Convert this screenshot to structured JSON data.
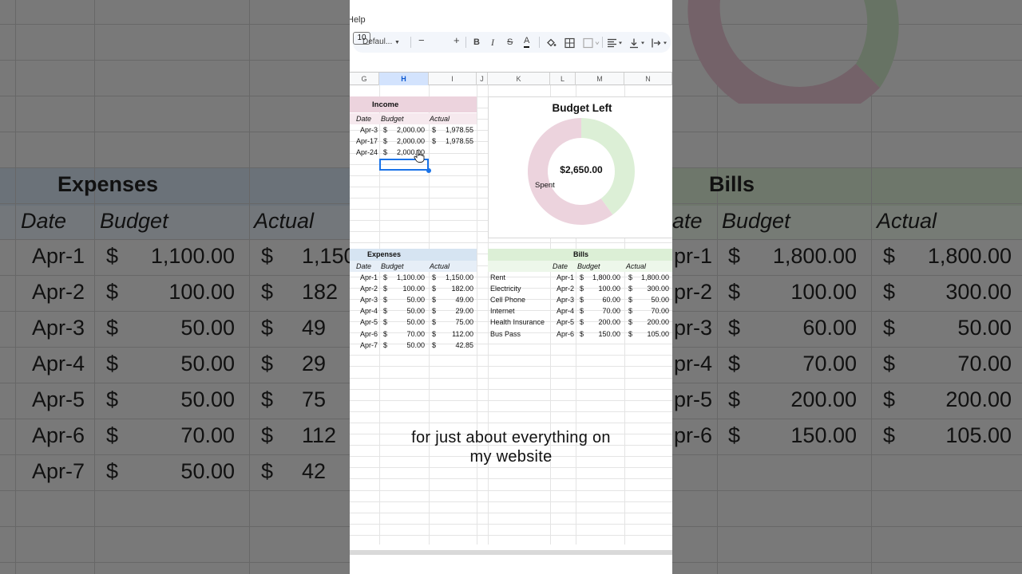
{
  "app": {
    "menu_fragment": "Help",
    "font_name": "Defaul...",
    "font_size": "10",
    "columns": [
      "G",
      "H",
      "I",
      "J",
      "K",
      "L",
      "M",
      "N"
    ],
    "selected_column": "H"
  },
  "toolbar_icons": [
    "minus-icon",
    "plus-icon",
    "bold-icon",
    "italic-icon",
    "strikethrough-icon",
    "text-color-icon",
    "fill-color-icon",
    "borders-icon",
    "merge-cells-icon",
    "align-left-icon",
    "vertical-align-icon",
    "text-wrap-icon"
  ],
  "income": {
    "title": "Income",
    "headers": [
      "Date",
      "Budget",
      "Actual"
    ],
    "rows": [
      {
        "date": "Apr-3",
        "budget": "2,000.00",
        "actual": "1,978.55"
      },
      {
        "date": "Apr-17",
        "budget": "2,000.00",
        "actual": "1,978.55"
      },
      {
        "date": "Apr-24",
        "budget": "2,000.00",
        "actual": ""
      }
    ],
    "currency": "$",
    "color": "#ecd3dd"
  },
  "chart": {
    "title": "Budget Left",
    "center_value": "$2,650.00",
    "slice_label": "Spent",
    "colors": {
      "spent": "#ecd3dd",
      "left": "#dcefd6"
    }
  },
  "chart_data": {
    "type": "pie",
    "title": "Budget Left",
    "categories": [
      "Left",
      "Spent"
    ],
    "values": [
      40,
      60
    ],
    "hole": true
  },
  "expenses": {
    "title": "Expenses",
    "headers": [
      "Date",
      "Budget",
      "Actual"
    ],
    "rows": [
      {
        "date": "Apr-1",
        "budget": "1,100.00",
        "actual": "1,150.00"
      },
      {
        "date": "Apr-2",
        "budget": "100.00",
        "actual": "182.00"
      },
      {
        "date": "Apr-3",
        "budget": "50.00",
        "actual": "49.00"
      },
      {
        "date": "Apr-4",
        "budget": "50.00",
        "actual": "29.00"
      },
      {
        "date": "Apr-5",
        "budget": "50.00",
        "actual": "75.00"
      },
      {
        "date": "Apr-6",
        "budget": "70.00",
        "actual": "112.00"
      },
      {
        "date": "Apr-7",
        "budget": "50.00",
        "actual": "42.85"
      }
    ],
    "currency": "$",
    "color": "#d6e4f2"
  },
  "bills": {
    "title": "Bills",
    "headers": [
      "Date",
      "Budget",
      "Actual"
    ],
    "rows": [
      {
        "name": "Rent",
        "date": "Apr-1",
        "budget": "1,800.00",
        "actual": "1,800.00"
      },
      {
        "name": "Electricity",
        "date": "Apr-2",
        "budget": "100.00",
        "actual": "300.00"
      },
      {
        "name": "Cell Phone",
        "date": "Apr-3",
        "budget": "60.00",
        "actual": "50.00"
      },
      {
        "name": "Internet",
        "date": "Apr-4",
        "budget": "70.00",
        "actual": "70.00"
      },
      {
        "name": "Health Insurance",
        "date": "Apr-5",
        "budget": "200.00",
        "actual": "200.00"
      },
      {
        "name": "Bus Pass",
        "date": "Apr-6",
        "budget": "150.00",
        "actual": "105.00"
      }
    ],
    "currency": "$",
    "color": "#dcefd6"
  },
  "caption": {
    "line1": "for just about everything on",
    "line2": "my website"
  },
  "background": {
    "left_title": "Expenses",
    "left_headers": [
      "Date",
      "Budget",
      "Actual"
    ],
    "left_rows": [
      {
        "date": "Apr-1",
        "budget": "1,100.00",
        "actual": "1,150"
      },
      {
        "date": "Apr-2",
        "budget": "100.00",
        "actual": "182"
      },
      {
        "date": "Apr-3",
        "budget": "50.00",
        "actual": "49"
      },
      {
        "date": "Apr-4",
        "budget": "50.00",
        "actual": "29"
      },
      {
        "date": "Apr-5",
        "budget": "50.00",
        "actual": "75"
      },
      {
        "date": "Apr-6",
        "budget": "70.00",
        "actual": "112"
      },
      {
        "date": "Apr-7",
        "budget": "50.00",
        "actual": "42"
      }
    ],
    "right_title": "Bills",
    "right_headers": [
      "ate",
      "Budget",
      "Actual"
    ],
    "right_rows": [
      {
        "date": "pr-1",
        "budget": "1,800.00",
        "actual": "1,800.00"
      },
      {
        "date": "pr-2",
        "budget": "100.00",
        "actual": "300.00"
      },
      {
        "date": "pr-3",
        "budget": "60.00",
        "actual": "50.00"
      },
      {
        "date": "pr-4",
        "budget": "70.00",
        "actual": "70.00"
      },
      {
        "date": "pr-5",
        "budget": "200.00",
        "actual": "200.00"
      },
      {
        "date": "pr-6",
        "budget": "150.00",
        "actual": "105.00"
      }
    ]
  }
}
